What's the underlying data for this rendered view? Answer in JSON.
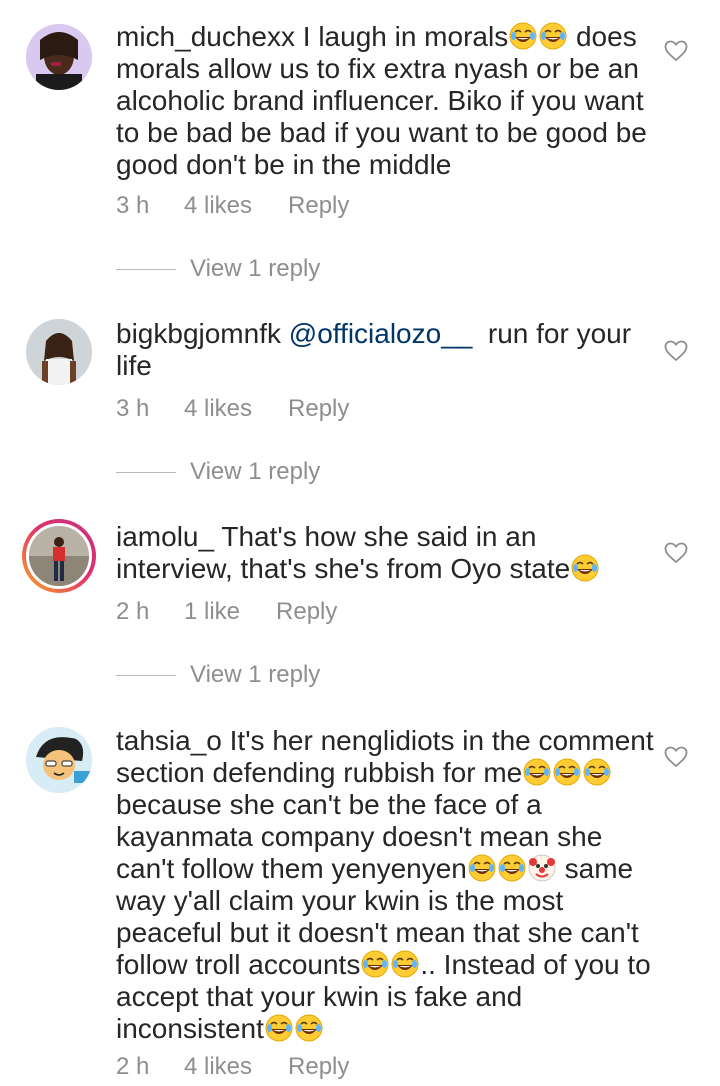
{
  "comments": [
    {
      "username": "mich_duchexx",
      "text_parts": [
        "I laugh in morals",
        " does morals allow us to fix extra nyash or be an alcoholic brand influencer. Biko if you want to be bad be bad if you want to be good be good don't be in the middle"
      ],
      "time": "3 h",
      "likes": "4 likes",
      "reply_label": "Reply",
      "view_replies": "View 1 reply"
    },
    {
      "username": "bigkbgjomnfk",
      "mention": "@officialozo__",
      "text": "  run for your life",
      "time": "3 h",
      "likes": "4 likes",
      "reply_label": "Reply",
      "view_replies": "View 1 reply"
    },
    {
      "username": "iamolu_",
      "text": "That's how she said in an interview, that's she's from Oyo state",
      "time": "2 h",
      "likes": "1 like",
      "reply_label": "Reply",
      "view_replies": "View 1 reply"
    },
    {
      "username": "tahsia_o",
      "text_parts": [
        "It's her nenglidiots in the comment section defending rubbish for me",
        " because she can't be the face of a kayanmata company doesn't mean she can't follow them yenyenyen",
        " same way y'all claim your kwin is the most peaceful but it doesn't mean that she can't follow troll accounts",
        ".. Instead of you to accept that your kwin is fake and inconsistent"
      ],
      "time": "2 h",
      "likes": "4 likes",
      "reply_label": "Reply"
    }
  ],
  "icons": {
    "like": "heart-outline-icon",
    "laugh": "face-with-tears-of-joy-emoji",
    "clown": "clown-face-emoji"
  },
  "colors": {
    "text": "#262626",
    "meta": "#8e8e8e",
    "mention": "#003569"
  }
}
